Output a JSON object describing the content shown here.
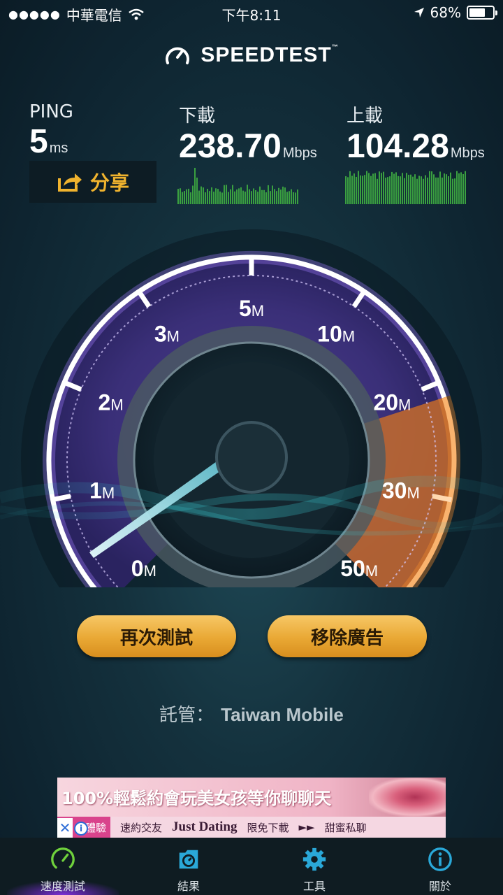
{
  "status_bar": {
    "signal": "●●●●●",
    "carrier": "中華電信",
    "time": "下午8:11",
    "battery_text": "68%",
    "battery_level": 0.68
  },
  "logo": {
    "text": "SPEEDTEST",
    "tm": "™"
  },
  "ping": {
    "label": "PING",
    "value": "5",
    "unit": "ms"
  },
  "download": {
    "label": "下載",
    "value": "238.70",
    "unit": "Mbps"
  },
  "upload": {
    "label": "上載",
    "value": "104.28",
    "unit": "Mbps"
  },
  "share_label": "分享",
  "gauge": {
    "ticks": [
      {
        "num": "0",
        "unit": "M"
      },
      {
        "num": "1",
        "unit": "M"
      },
      {
        "num": "2",
        "unit": "M"
      },
      {
        "num": "3",
        "unit": "M"
      },
      {
        "num": "5",
        "unit": "M"
      },
      {
        "num": "10",
        "unit": "M"
      },
      {
        "num": "20",
        "unit": "M"
      },
      {
        "num": "30",
        "unit": "M"
      },
      {
        "num": "50",
        "unit": "M"
      }
    ],
    "accent_purple": "#8a5cf0",
    "accent_orange": "#f08a2c"
  },
  "buttons": {
    "retest": "再次測試",
    "remove_ads": "移除廣告"
  },
  "host": {
    "label": "託管：",
    "name": "Taiwan Mobile"
  },
  "ad": {
    "headline": "100%輕鬆約會玩美女孩等你聊聊天",
    "tag": "體驗",
    "item1": "速約交友",
    "brand": "Just Dating",
    "item2": "限免下載",
    "arrows": "►►",
    "item3": "甜蜜私聊",
    "close": "✕",
    "info": "i"
  },
  "tabs": [
    {
      "label": "速度測試",
      "icon": "speedometer-icon"
    },
    {
      "label": "結果",
      "icon": "results-icon"
    },
    {
      "label": "工具",
      "icon": "gear-icon"
    },
    {
      "label": "關於",
      "icon": "info-icon"
    }
  ]
}
